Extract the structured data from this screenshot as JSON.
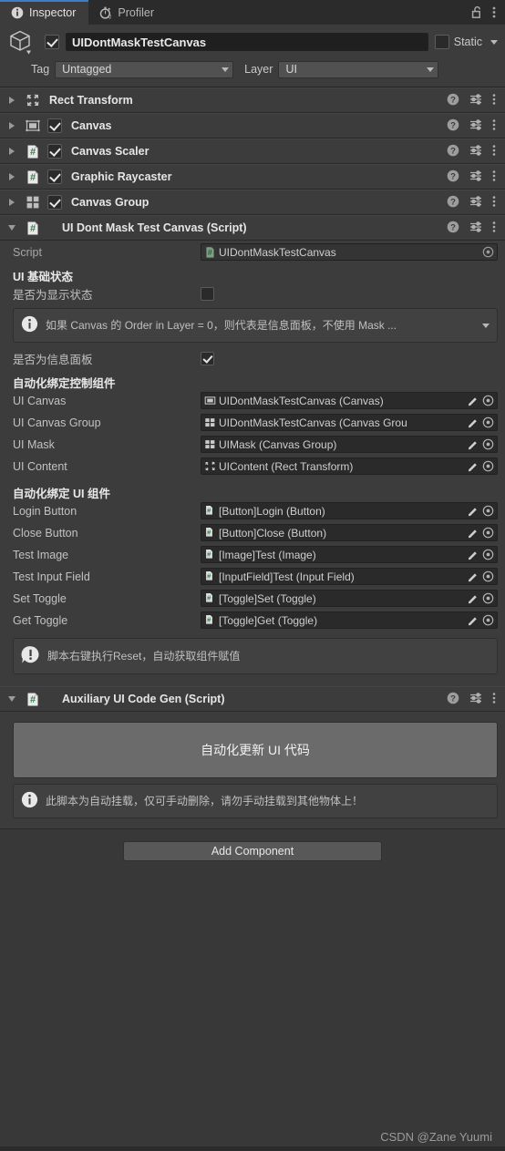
{
  "tabs": [
    {
      "label": "Inspector",
      "icon": "info-icon",
      "active": true
    },
    {
      "label": "Profiler",
      "icon": "stopwatch-icon",
      "active": false
    }
  ],
  "tabbar_right": {
    "lock_icon": "lock-open-icon",
    "menu_icon": "kebab-menu-icon"
  },
  "object_header": {
    "enabled": true,
    "name": "UIDontMaskTestCanvas",
    "static_label": "Static",
    "static_checked": false,
    "tag_label": "Tag",
    "tag_value": "Untagged",
    "layer_label": "Layer",
    "layer_value": "UI"
  },
  "components": [
    {
      "name": "Rect Transform",
      "icon": "rect-transform-icon",
      "has_toggle": false,
      "enabled": false,
      "expanded": false
    },
    {
      "name": "Canvas",
      "icon": "canvas-icon",
      "has_toggle": true,
      "enabled": true,
      "expanded": false
    },
    {
      "name": "Canvas Scaler",
      "icon": "script-icon",
      "has_toggle": true,
      "enabled": true,
      "expanded": false
    },
    {
      "name": "Graphic Raycaster",
      "icon": "script-icon",
      "has_toggle": true,
      "enabled": true,
      "expanded": false
    },
    {
      "name": "Canvas Group",
      "icon": "canvas-group-icon",
      "has_toggle": true,
      "enabled": true,
      "expanded": false
    },
    {
      "name": "UI Dont Mask Test Canvas (Script)",
      "icon": "script-icon",
      "has_toggle": false,
      "enabled": false,
      "expanded": true
    }
  ],
  "component_header_icons": {
    "help": "help-icon",
    "preset": "preset-icon",
    "menu": "kebab-menu-icon"
  },
  "script_component": {
    "script_label": "Script",
    "script_value": "UIDontMaskTestCanvas",
    "section_state": "UI 基础状态",
    "is_show_label": "是否为显示状态",
    "is_show_checked": false,
    "info_note": "如果 Canvas 的 Order in Layer = 0，则代表是信息面板，不使用 Mask ...",
    "is_info_panel_label": "是否为信息面板",
    "is_info_panel_checked": true,
    "section_control": "自动化绑定控制组件",
    "control_fields": [
      {
        "label": "UI Canvas",
        "value": "UIDontMaskTestCanvas (Canvas)",
        "icon": "canvas-icon"
      },
      {
        "label": "UI Canvas Group",
        "value": "UIDontMaskTestCanvas (Canvas Grou",
        "icon": "canvas-group-icon"
      },
      {
        "label": "UI Mask",
        "value": "UIMask (Canvas Group)",
        "icon": "canvas-group-icon"
      },
      {
        "label": "UI Content",
        "value": "UIContent (Rect Transform)",
        "icon": "rect-transform-icon"
      }
    ],
    "section_ui": "自动化绑定 UI 组件",
    "ui_fields": [
      {
        "label": "Login Button",
        "value": "[Button]Login (Button)",
        "icon": "script-icon"
      },
      {
        "label": "Close Button",
        "value": "[Button]Close (Button)",
        "icon": "script-icon"
      },
      {
        "label": "Test Image",
        "value": "[Image]Test (Image)",
        "icon": "script-icon"
      },
      {
        "label": "Test Input Field",
        "value": "[InputField]Test (Input Field)",
        "icon": "script-icon"
      },
      {
        "label": "Set Toggle",
        "value": "[Toggle]Set (Toggle)",
        "icon": "script-icon"
      },
      {
        "label": "Get Toggle",
        "value": "[Toggle]Get (Toggle)",
        "icon": "script-icon"
      }
    ],
    "warning_note": "脚本右键执行Reset，自动获取组件赋值"
  },
  "auxiliary_component": {
    "title": "Auxiliary UI Code Gen (Script)",
    "button_label": "自动化更新 UI 代码",
    "info_note": "此脚本为自动挂载，仅可手动删除，请勿手动挂载到其他物体上！"
  },
  "footer": {
    "add_component": "Add Component",
    "watermark": "CSDN @Zane Yuumi"
  },
  "colors": {
    "background": "#383838",
    "panel": "#3c3c3c",
    "tabbar": "#2b2b2b",
    "accent": "#3d7cc9",
    "field": "#2a2a2a",
    "script_green": "#5aa469"
  }
}
